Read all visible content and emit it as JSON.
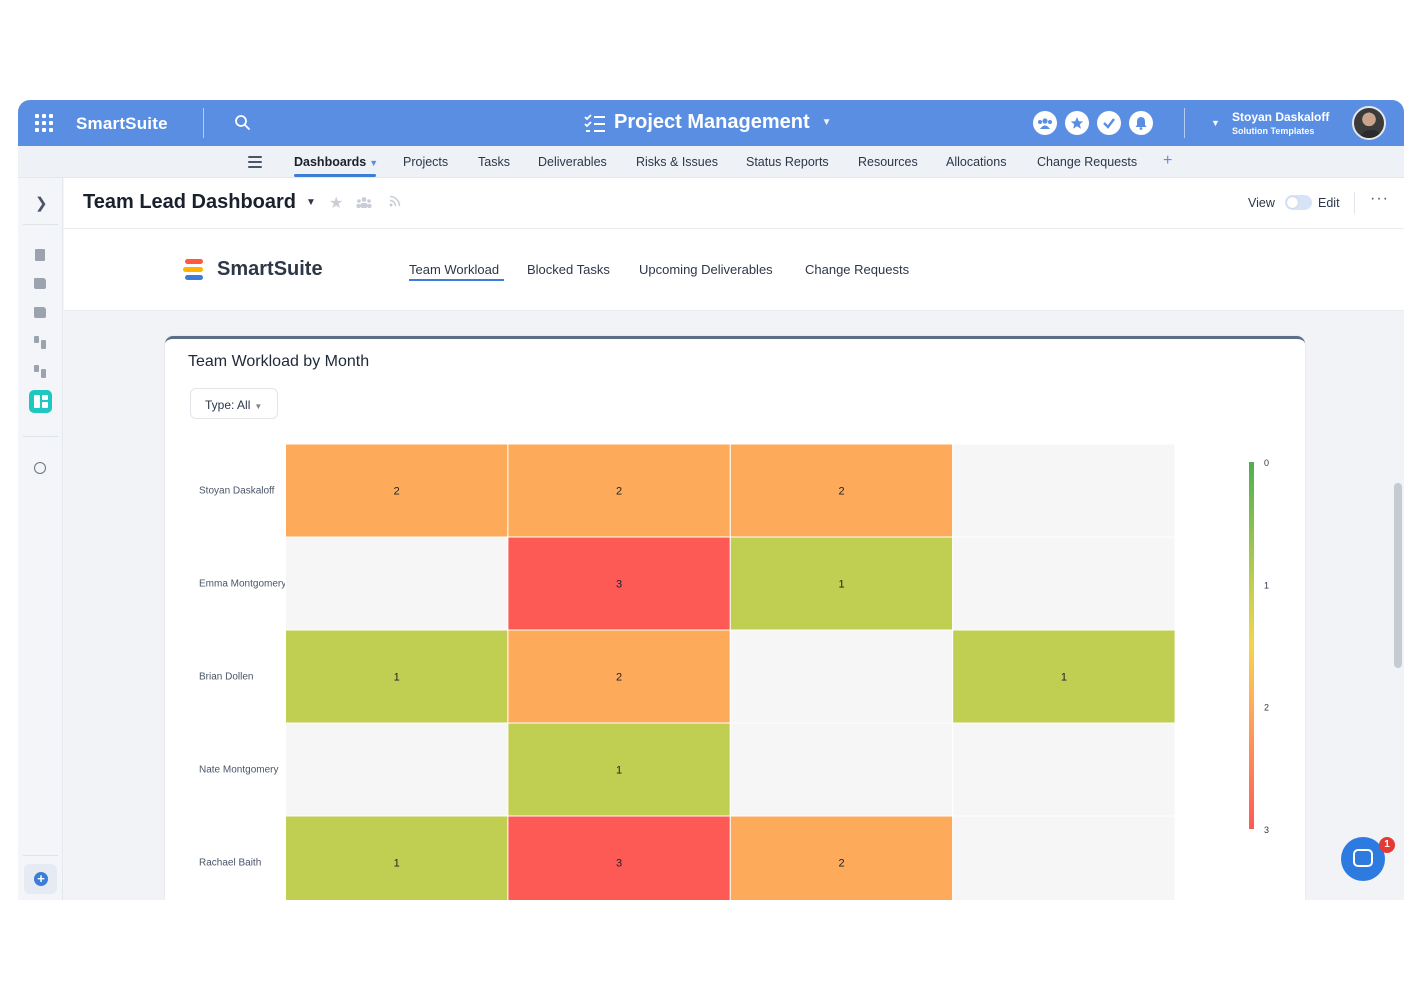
{
  "topbar": {
    "brand": "SmartSuite",
    "workspace_title": "Project Management",
    "user_name": "Stoyan Daskaloff",
    "user_subtitle": "Solution Templates"
  },
  "nav": {
    "items": [
      "Dashboards",
      "Projects",
      "Tasks",
      "Deliverables",
      "Risks & Issues",
      "Status Reports",
      "Resources",
      "Allocations",
      "Change Requests"
    ],
    "active": "Dashboards"
  },
  "dashboard": {
    "title": "Team Lead Dashboard",
    "view_label": "View",
    "edit_label": "Edit",
    "brand": "SmartSuite",
    "tabs": [
      "Team Workload",
      "Blocked Tasks",
      "Upcoming Deliverables",
      "Change Requests"
    ],
    "active_tab": "Team Workload"
  },
  "widget": {
    "title": "Team Workload by Month",
    "filter_label": "Type: All"
  },
  "chart_data": {
    "type": "heatmap",
    "rows": [
      "Stoyan Daskaloff",
      "Emma Montgomery",
      "Brian Dollen",
      "Nate Montgomery",
      "Rachael Baith"
    ],
    "columns_visible": 4,
    "values": [
      [
        2,
        2,
        2,
        null
      ],
      [
        null,
        3,
        1,
        null
      ],
      [
        1,
        2,
        null,
        1
      ],
      [
        null,
        1,
        null,
        null
      ],
      [
        1,
        3,
        2,
        null
      ]
    ],
    "colorscale": {
      "ticks": [
        "0",
        "1",
        "2",
        "3"
      ],
      "min": 0,
      "max": 3,
      "colors": {
        "0": "#4caf50",
        "1": "#c0ce52",
        "1.5": "#f5d44e",
        "2": "#fdab5a",
        "3": "#fd5a56"
      },
      "empty_color": "#f6f6f6"
    }
  },
  "chat": {
    "badge": "1"
  }
}
